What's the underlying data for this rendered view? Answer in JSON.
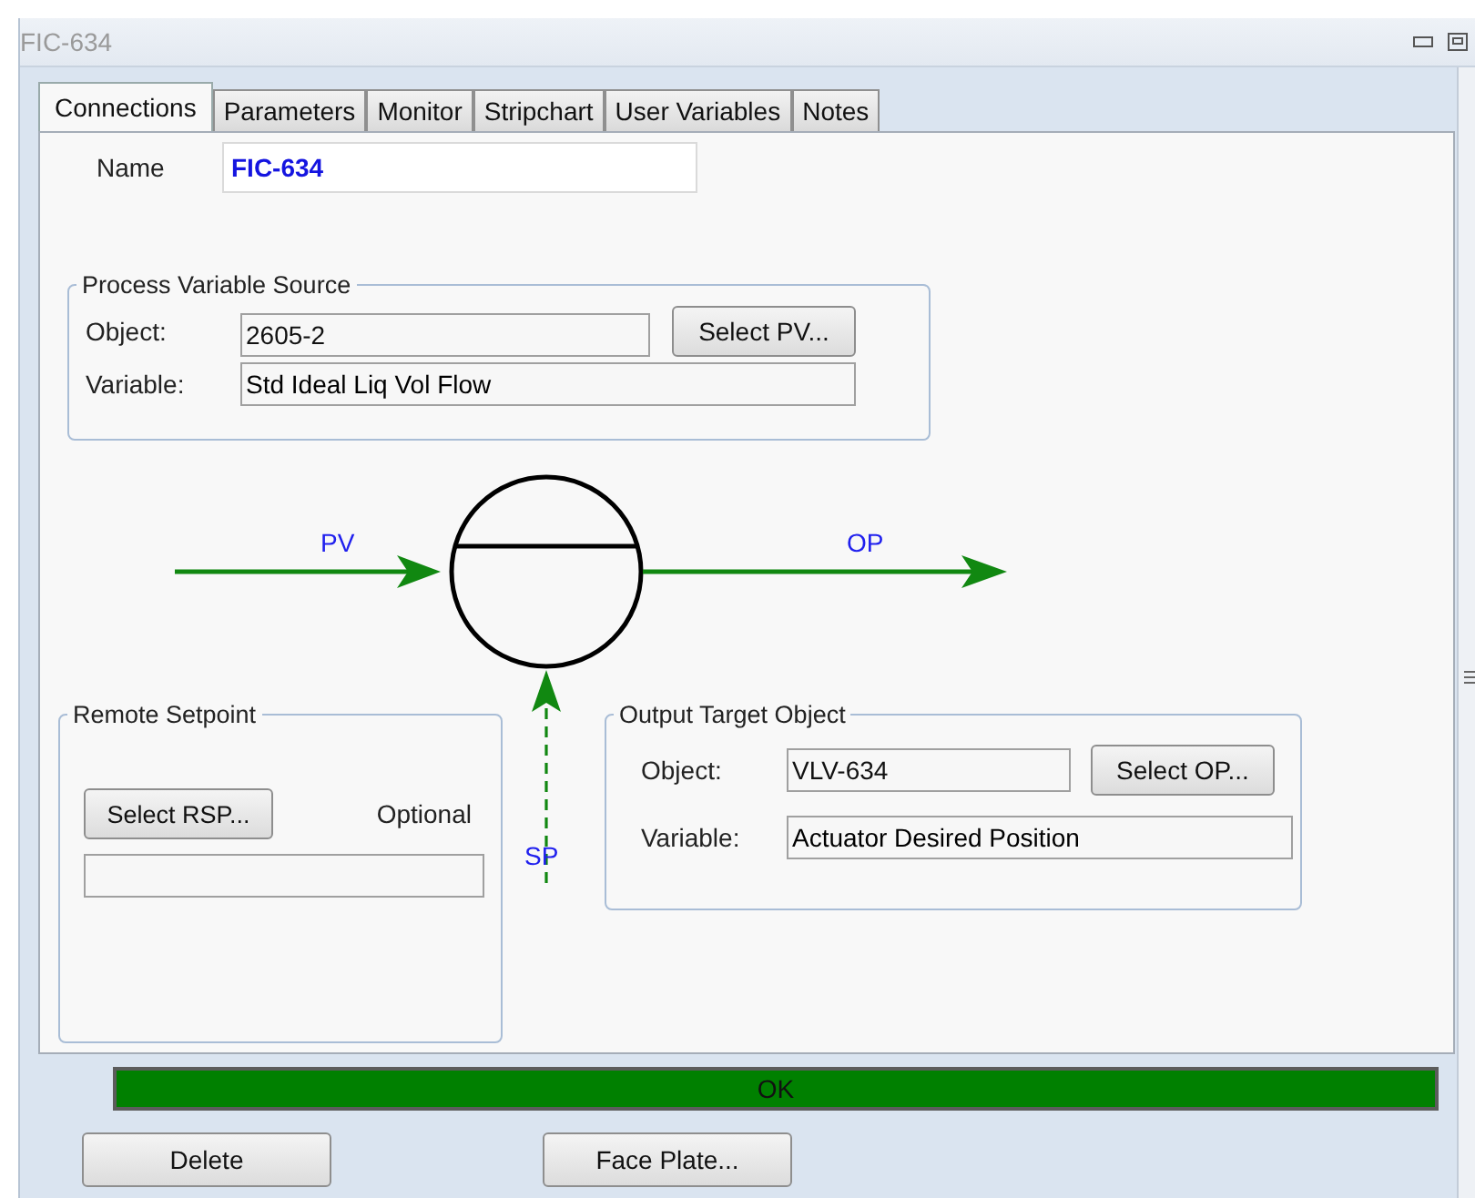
{
  "window": {
    "title": "FIC-634"
  },
  "tabs": [
    {
      "label": "Connections",
      "selected": true
    },
    {
      "label": "Parameters",
      "selected": false
    },
    {
      "label": "Monitor",
      "selected": false
    },
    {
      "label": "Stripchart",
      "selected": false
    },
    {
      "label": "User Variables",
      "selected": false
    },
    {
      "label": "Notes",
      "selected": false
    }
  ],
  "name": {
    "label": "Name",
    "value": "FIC-634"
  },
  "pv_source": {
    "title": "Process Variable Source",
    "object_label": "Object:",
    "object_value": "2605-2",
    "button": "Select PV...",
    "variable_label": "Variable:",
    "variable_value": "Std Ideal Liq Vol Flow"
  },
  "diagram": {
    "pv_label": "PV",
    "op_label": "OP",
    "sp_label": "SP"
  },
  "remote_setpoint": {
    "title": "Remote Setpoint",
    "button": "Select RSP...",
    "note": "Optional"
  },
  "output_target": {
    "title": "Output Target Object",
    "object_label": "Object:",
    "object_value": "VLV-634",
    "button": "Select OP...",
    "variable_label": "Variable:",
    "variable_value": "Actuator Desired Position"
  },
  "status": {
    "text": "OK"
  },
  "buttons": [
    "Delete",
    "Face Plate..."
  ]
}
